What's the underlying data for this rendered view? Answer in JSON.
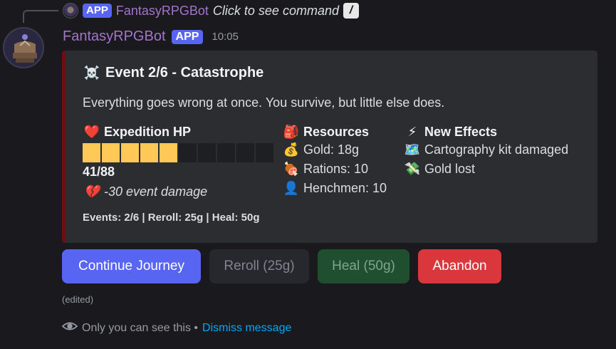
{
  "reply": {
    "app_tag": "APP",
    "author": "FantasyRPGBot",
    "text": "Click to see command",
    "command_icon": "slash-command-icon"
  },
  "message": {
    "author": "FantasyRPGBot",
    "app_tag": "APP",
    "time": "10:05",
    "edited": "(edited)"
  },
  "embed": {
    "accent_color": "#6b0f0f",
    "title_icon": "☠️",
    "title": "Event 2/6 - Catastrophe",
    "description": "Everything goes wrong at once. You survive, but little else does.",
    "fields": {
      "hp": {
        "icon": "❤️",
        "name": "Expedition HP",
        "current": 41,
        "max": 88,
        "bar_filled": 5,
        "bar_total": 10,
        "value": "41/88",
        "damage_icon": "💔",
        "damage": "-30 event damage"
      },
      "resources": {
        "icon": "🎒",
        "name": "Resources",
        "lines": [
          {
            "icon": "💰",
            "text": "Gold: 18g"
          },
          {
            "icon": "🍖",
            "text": "Rations: 10"
          },
          {
            "icon": "👤",
            "text": "Henchmen: 10"
          }
        ]
      },
      "effects": {
        "icon": "⚡",
        "name": "New Effects",
        "lines": [
          {
            "icon": "🗺️",
            "text": "Cartography kit damaged"
          },
          {
            "icon": "💸",
            "text": "Gold lost"
          }
        ]
      }
    },
    "footer": "Events: 2/6 | Reroll: 25g | Heal: 50g"
  },
  "buttons": {
    "continue": "Continue Journey",
    "reroll": "Reroll (25g)",
    "heal": "Heal (50g)",
    "abandon": "Abandon"
  },
  "notice": {
    "text": "Only you can see this •",
    "dismiss": "Dismiss message"
  },
  "colors": {
    "hp_bar": "#ffc857",
    "primary": "#5865f2",
    "danger": "#da373c",
    "success": "#1f4f2f"
  }
}
